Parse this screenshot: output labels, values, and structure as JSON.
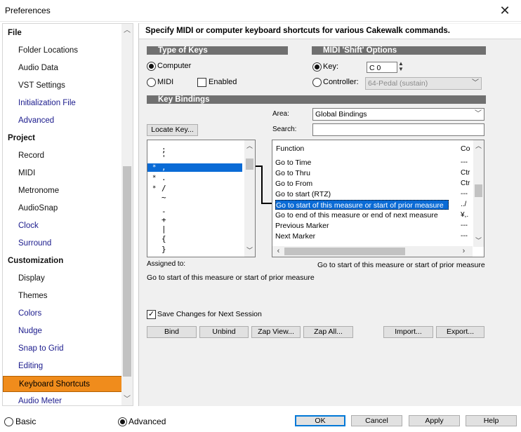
{
  "window": {
    "title": "Preferences"
  },
  "sidebar": {
    "items": [
      {
        "label": "File",
        "type": "group"
      },
      {
        "label": "Folder Locations",
        "type": "child"
      },
      {
        "label": "Audio Data",
        "type": "child"
      },
      {
        "label": "VST Settings",
        "type": "child"
      },
      {
        "label": "Initialization File",
        "type": "link"
      },
      {
        "label": "Advanced",
        "type": "link"
      },
      {
        "label": "Project",
        "type": "group"
      },
      {
        "label": "Record",
        "type": "child"
      },
      {
        "label": "MIDI",
        "type": "child"
      },
      {
        "label": "Metronome",
        "type": "child"
      },
      {
        "label": "AudioSnap",
        "type": "child"
      },
      {
        "label": "Clock",
        "type": "link"
      },
      {
        "label": "Surround",
        "type": "link"
      },
      {
        "label": "Customization",
        "type": "group"
      },
      {
        "label": "Display",
        "type": "child"
      },
      {
        "label": "Themes",
        "type": "child"
      },
      {
        "label": "Colors",
        "type": "link"
      },
      {
        "label": "Nudge",
        "type": "link"
      },
      {
        "label": "Snap to Grid",
        "type": "link"
      },
      {
        "label": "Editing",
        "type": "link"
      },
      {
        "label": "Keyboard Shortcuts",
        "type": "selected"
      },
      {
        "label": "Audio Meter",
        "type": "link"
      }
    ]
  },
  "header": {
    "description": "Specify MIDI or computer keyboard shortcuts for various Cakewalk commands."
  },
  "type_of_keys": {
    "title": "Type of Keys",
    "computer_label": "Computer",
    "midi_label": "MIDI",
    "enabled_label": "Enabled",
    "selected": "computer"
  },
  "midi_shift": {
    "title": "MIDI 'Shift' Options",
    "key_label": "Key:",
    "key_value": "C 0",
    "controller_label": "Controller:",
    "controller_value": "64-Pedal (sustain)",
    "selected": "key"
  },
  "key_bindings": {
    "title": "Key Bindings",
    "area_label": "Area:",
    "area_value": "Global Bindings",
    "search_label": "Search:",
    "search_value": "",
    "locate_key_label": "Locate Key...",
    "keys": [
      {
        "mark": "",
        "key": ";"
      },
      {
        "mark": "",
        "key": "'"
      },
      {
        "mark": "*",
        "key": ","
      },
      {
        "mark": "*",
        "key": "."
      },
      {
        "mark": "*",
        "key": "/"
      },
      {
        "mark": "",
        "key": "~"
      },
      {
        "mark": "",
        "key": "-"
      },
      {
        "mark": "",
        "key": "+"
      },
      {
        "mark": "",
        "key": "|"
      },
      {
        "mark": "",
        "key": "{"
      },
      {
        "mark": "",
        "key": "}"
      }
    ],
    "selected_key_index": 2,
    "columns": {
      "function": "Function",
      "code": "Co"
    },
    "functions": [
      {
        "name": "Go to Time",
        "code": "---"
      },
      {
        "name": "Go to Thru",
        "code": "Ctr"
      },
      {
        "name": "Go to From",
        "code": "Ctr"
      },
      {
        "name": "Go to start (RTZ)",
        "code": "---"
      },
      {
        "name": "Go to start of this measure or start of prior measure",
        "code": "../"
      },
      {
        "name": "Go to end of this measure or end of next measure",
        "code": "¥,."
      },
      {
        "name": "Previous Marker",
        "code": "---"
      },
      {
        "name": "Next Marker",
        "code": "---"
      }
    ],
    "selected_function_index": 4,
    "assigned_to_label": "Assigned to:",
    "assigned_to_value": "Go to start of this measure or start of prior measure",
    "function_caption": "Go to start of this measure or start of prior measure"
  },
  "options": {
    "save_changes_label": "Save Changes for Next Session",
    "save_changes_checked": true
  },
  "actions": {
    "bind": "Bind",
    "unbind": "Unbind",
    "zap_view": "Zap View...",
    "zap_all": "Zap All...",
    "import": "Import...",
    "export": "Export..."
  },
  "footer": {
    "basic_label": "Basic",
    "advanced_label": "Advanced",
    "mode_selected": "advanced",
    "ok": "OK",
    "cancel": "Cancel",
    "apply": "Apply",
    "help": "Help"
  },
  "colors": {
    "sidebar_selected": "#f08c1c",
    "list_selection": "#0a6bd6",
    "section_bar": "#707070",
    "link_text": "#1a1a8c"
  },
  "icons": {
    "close": "close-icon",
    "scroll_up": "chevron-up-icon",
    "scroll_down": "chevron-down-icon",
    "scroll_left": "chevron-left-icon",
    "scroll_right": "chevron-right-icon",
    "spin": "spin-arrows-icon",
    "check": "checkmark-icon"
  }
}
